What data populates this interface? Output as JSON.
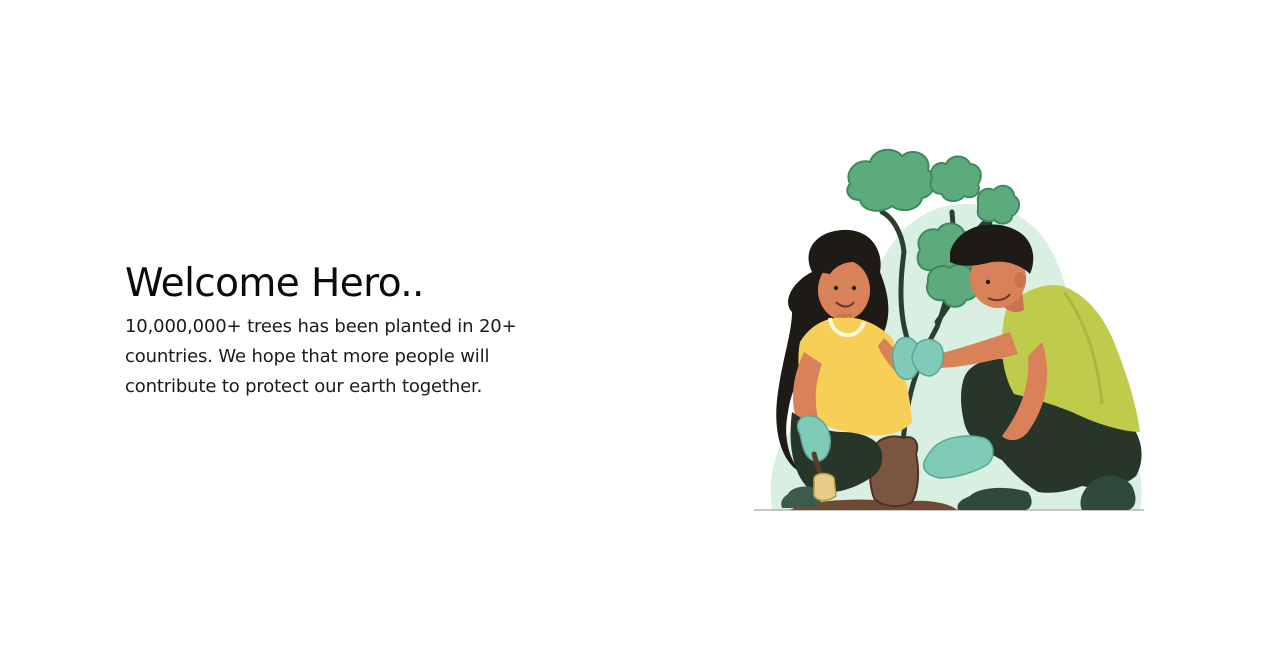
{
  "hero": {
    "title": "Welcome Hero..",
    "description": "10,000,000+ trees has been planted in 20+ countries. We hope that more people will contribute to protect our earth together."
  },
  "illustration": {
    "subject": "two people planting a tree",
    "icon": "tree-planting-illustration"
  },
  "colors": {
    "text": "#111111",
    "leaf": "#5bab7c",
    "shirt_yellow": "#f7cf57",
    "shirt_green": "#bfcc4b",
    "glove": "#7fcbb8",
    "pants": "#273629",
    "skin": "#d9825a",
    "background_blob": "#d8efe2"
  }
}
